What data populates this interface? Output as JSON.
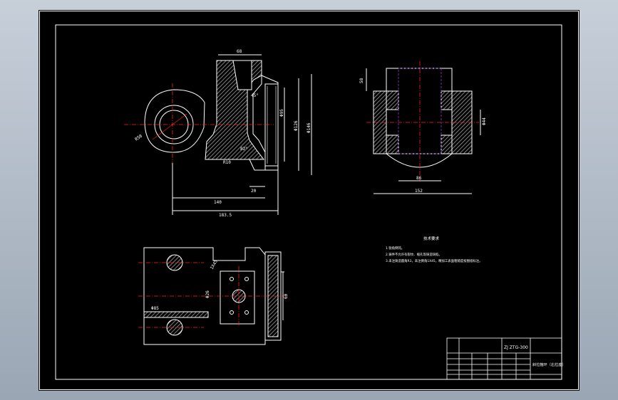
{
  "colors": {
    "outline": "#ffffff",
    "centerline": "#ff2020",
    "hatch": "#9a9a9a",
    "dimension": "#ffffff",
    "sheet": "#000000",
    "hidden": "#7030a0"
  },
  "views": {
    "front": {
      "dims": {
        "top_width": "68",
        "r_outer": "R58",
        "d_bore": "Φ95",
        "d_mid": "Φ126",
        "d_outer": "Φ146",
        "angle_upper": "45°",
        "angle_lower": "82°",
        "r_fillet": "R10",
        "w_step": "20",
        "w_base": "140",
        "w_total": "183.5"
      }
    },
    "side": {
      "dims": {
        "height": "58",
        "d_boss": "Φ44",
        "w_inner": "86",
        "w_total": "152"
      }
    },
    "top": {
      "dims": {
        "chamfer": "1X45",
        "d_hole": "Φ26",
        "depth": "Φ85",
        "width": "60"
      }
    }
  },
  "notes": {
    "title": "技术要求",
    "items": [
      "1.锐角倒钝。",
      "2.铸件不允许有裂纹、缩孔等铸造缺陷。",
      "3.未注铸造圆角R3，未注倒角1X45，精加工表面粗糙度按图纸标注。"
    ]
  },
  "title_block": {
    "drawing_no": "ZJ ZTG-300",
    "part_name": "斜拉箍环（右拉座）"
  }
}
